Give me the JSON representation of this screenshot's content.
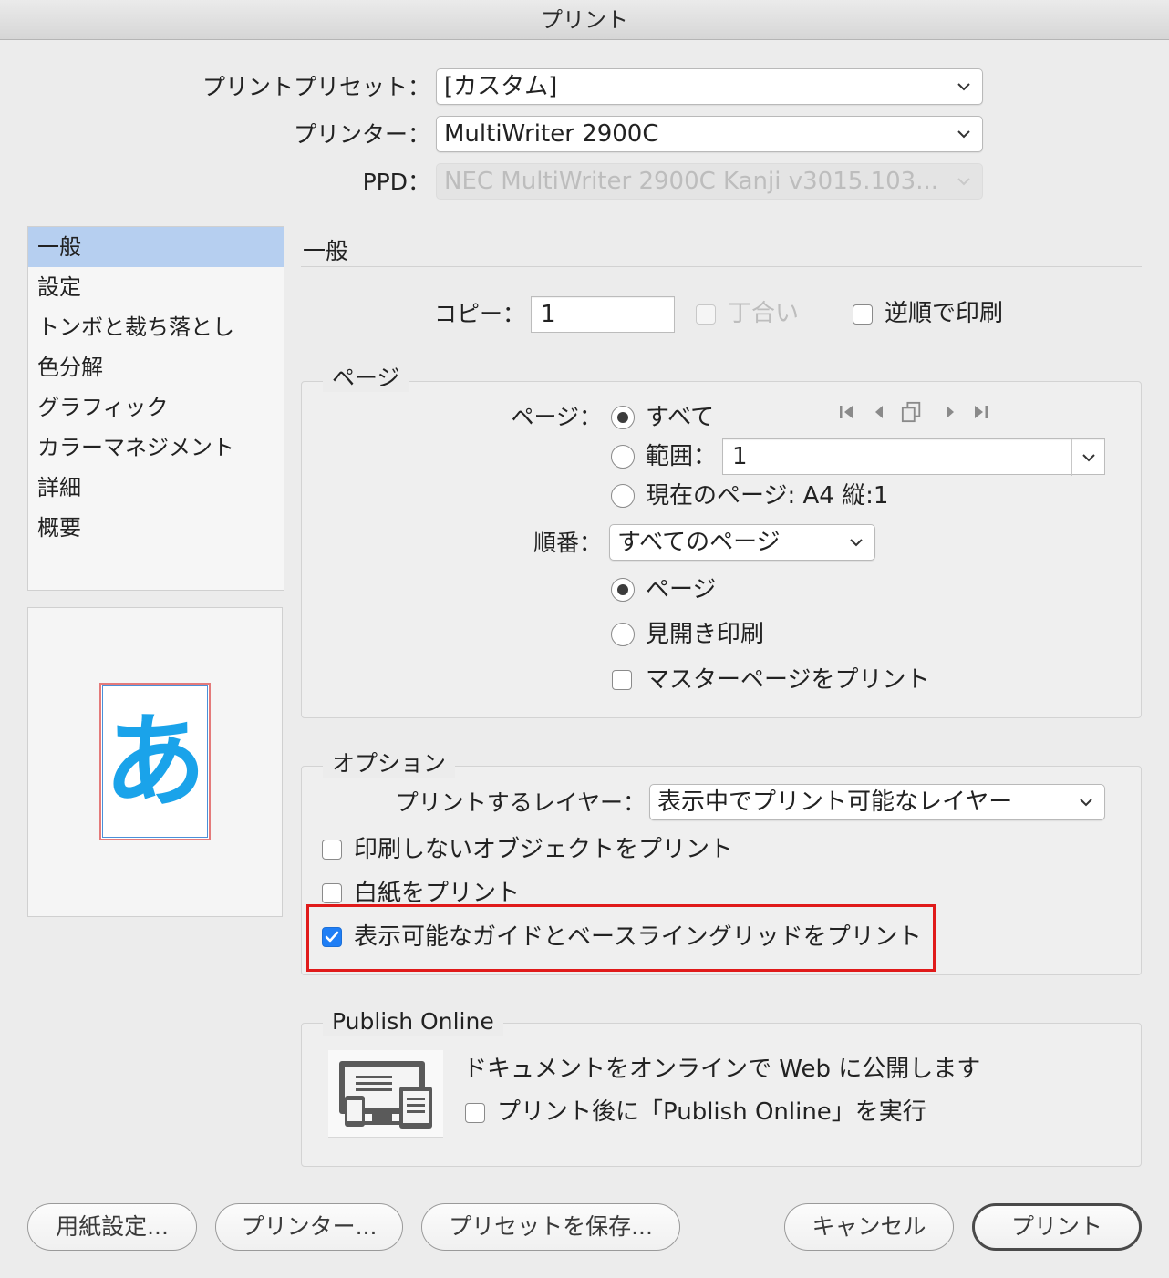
{
  "window": {
    "title": "プリント"
  },
  "top": {
    "preset_label": "プリントプリセット：",
    "preset_value": "[カスタム]",
    "printer_label": "プリンター：",
    "printer_value": "MultiWriter 2900C",
    "ppd_label": "PPD：",
    "ppd_value": "NEC MultiWriter 2900C Kanji v3015.103..."
  },
  "sidebar": {
    "items": [
      {
        "label": "一般"
      },
      {
        "label": "設定"
      },
      {
        "label": "トンボと裁ち落とし"
      },
      {
        "label": "色分解"
      },
      {
        "label": "グラフィック"
      },
      {
        "label": "カラーマネジメント"
      },
      {
        "label": "詳細"
      },
      {
        "label": "概要"
      }
    ],
    "preview_glyph": "あ"
  },
  "general": {
    "title": "一般",
    "copies_label": "コピー：",
    "copies_value": "1",
    "collate_label": "丁合い",
    "reverse_label": "逆順で印刷"
  },
  "pages": {
    "group_title": "ページ",
    "pages_label": "ページ：",
    "all_label": "すべて",
    "range_label": "範囲：",
    "range_value": "1",
    "current_label": "現在のページ: A4 縦:1",
    "order_label": "順番：",
    "order_value": "すべてのページ",
    "page_label": "ページ",
    "spread_label": "見開き印刷",
    "master_label": "マスターページをプリント"
  },
  "options": {
    "group_title": "オプション",
    "layers_label": "プリントするレイヤー：",
    "layers_value": "表示中でプリント可能なレイヤー",
    "nonprint_label": "印刷しないオブジェクトをプリント",
    "blank_label": "白紙をプリント",
    "guides_label": "表示可能なガイドとベースライングリッドをプリント"
  },
  "publish": {
    "group_title": "Publish Online",
    "description": "ドキュメントをオンラインで Web に公開します",
    "run_label": "プリント後に「Publish Online」を実行"
  },
  "buttons": {
    "page_setup": "用紙設定...",
    "printer": "プリンター...",
    "save_preset": "プリセットを保存...",
    "cancel": "キャンセル",
    "print": "プリント"
  },
  "colors": {
    "accent": "#1f7ef5",
    "selection": "#b6cff0",
    "highlight_box": "#e01a1a",
    "preview_glyph": "#1aa3ea"
  },
  "states": {
    "collate_checked": false,
    "collate_enabled": false,
    "reverse_checked": false,
    "page_radio": "all",
    "order_radio": "page",
    "master_checked": false,
    "nonprint_checked": false,
    "blank_checked": false,
    "guides_checked": true,
    "publish_run_checked": false
  }
}
